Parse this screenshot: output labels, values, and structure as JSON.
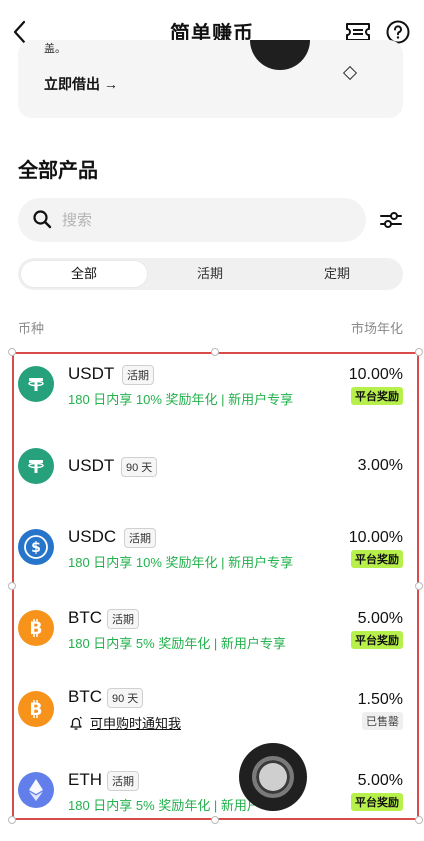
{
  "header": {
    "title": "简单赚币",
    "back_icon": "chevron-left-icon",
    "coupon_icon": "ticket-icon",
    "help_icon": "question-circle-icon"
  },
  "promo_card": {
    "note": "盖。",
    "link_label": "立即借出 →"
  },
  "products": {
    "section_title": "全部产品",
    "search_placeholder": "搜索",
    "tabs": [
      {
        "label": "全部",
        "active": true
      },
      {
        "label": "活期",
        "active": false
      },
      {
        "label": "定期",
        "active": false
      }
    ],
    "col_left": "币种",
    "col_right": "市场年化",
    "items": [
      {
        "coin": "USDT",
        "tag": "活期",
        "promo": "180 日内享 10% 奖励年化 | 新用户专享",
        "rate": "10.00%",
        "badge": "平台奖励",
        "icon": "tether-icon",
        "color": "#26a17b"
      },
      {
        "coin": "USDT",
        "tag": "90 天",
        "promo": "",
        "rate": "3.00%",
        "badge": "",
        "icon": "tether-icon",
        "color": "#26a17b"
      },
      {
        "coin": "USDC",
        "tag": "活期",
        "promo": "180 日内享 10% 奖励年化 | 新用户专享",
        "rate": "10.00%",
        "badge": "平台奖励",
        "icon": "usdc-icon",
        "color": "#2775ca"
      },
      {
        "coin": "BTC",
        "tag": "活期",
        "promo": "180 日内享 5% 奖励年化 | 新用户专享",
        "rate": "5.00%",
        "badge": "平台奖励",
        "icon": "bitcoin-icon",
        "color": "#f7931a"
      },
      {
        "coin": "BTC",
        "tag": "90 天",
        "notify": "可申购时通知我",
        "rate": "1.50%",
        "status": "已售罄",
        "icon": "bitcoin-icon",
        "color": "#f7931a"
      },
      {
        "coin": "ETH",
        "tag": "活期",
        "promo": "180 日内享 5% 奖励年化 | 新用户",
        "rate": "5.00%",
        "badge": "平台奖励",
        "icon": "ethereum-icon",
        "color": "#627eea"
      }
    ]
  }
}
